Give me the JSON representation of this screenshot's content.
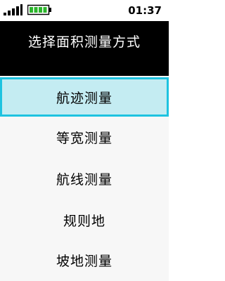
{
  "status_bar": {
    "signal_icon": "signal-strength-icon",
    "battery_icon": "battery-full-icon",
    "time": "01:37",
    "battery_color": "#2bb52b"
  },
  "header": {
    "title": "选择面积测量方式"
  },
  "menu": {
    "items": [
      {
        "label": "航迹测量",
        "selected": true
      },
      {
        "label": "等宽测量",
        "selected": false
      },
      {
        "label": "航线测量",
        "selected": false
      },
      {
        "label": "规则地",
        "selected": false
      },
      {
        "label": "坡地测量",
        "selected": false
      }
    ],
    "highlight_fill": "#c4ecf2",
    "highlight_border": "#1ec3e0"
  }
}
